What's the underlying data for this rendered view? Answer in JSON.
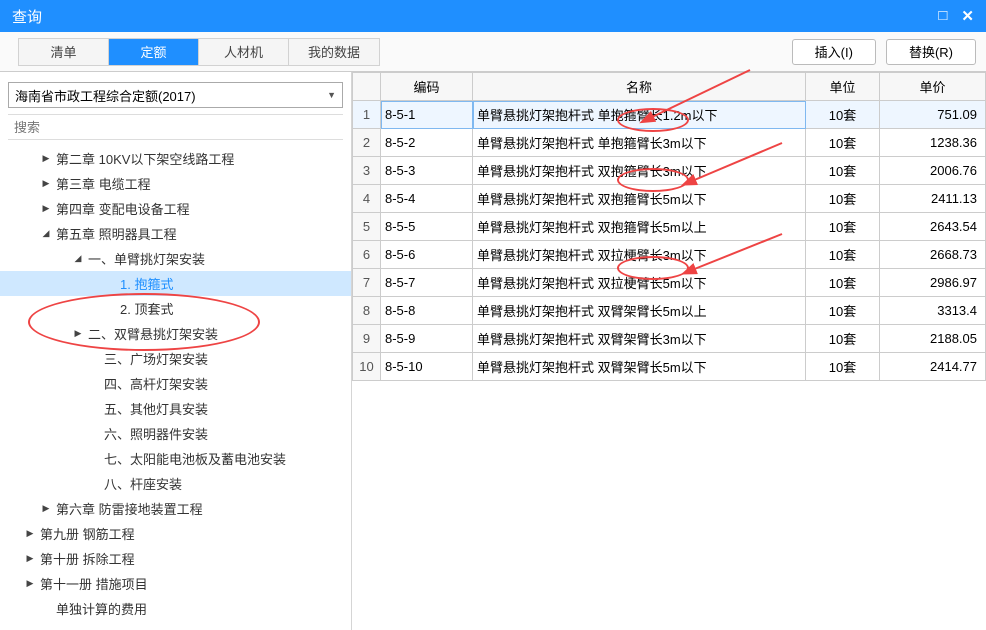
{
  "window": {
    "title": "查询"
  },
  "tabs": [
    {
      "label": "清单",
      "active": false
    },
    {
      "label": "定额",
      "active": true
    },
    {
      "label": "人材机",
      "active": false
    },
    {
      "label": "我的数据",
      "active": false
    }
  ],
  "buttons": {
    "insert": "插入(I)",
    "replace": "替换(R)"
  },
  "dropdown": {
    "value": "海南省市政工程综合定额(2017)"
  },
  "search": {
    "placeholder": "搜索"
  },
  "tree": [
    {
      "indent": 40,
      "toggle": "▶",
      "label": "第二章 10KV以下架空线路工程",
      "selected": false
    },
    {
      "indent": 40,
      "toggle": "▶",
      "label": "第三章 电缆工程",
      "selected": false
    },
    {
      "indent": 40,
      "toggle": "▶",
      "label": "第四章 变配电设备工程",
      "selected": false
    },
    {
      "indent": 40,
      "toggle": "◢",
      "label": "第五章 照明器具工程",
      "selected": false
    },
    {
      "indent": 72,
      "toggle": "◢",
      "label": "一、单臂挑灯架安装",
      "selected": false
    },
    {
      "indent": 104,
      "toggle": "",
      "label": "1. 抱箍式",
      "selected": true
    },
    {
      "indent": 104,
      "toggle": "",
      "label": "2. 顶套式",
      "selected": false
    },
    {
      "indent": 72,
      "toggle": "▶",
      "label": "二、双臂悬挑灯架安装",
      "selected": false
    },
    {
      "indent": 88,
      "toggle": "",
      "label": "三、广场灯架安装",
      "selected": false
    },
    {
      "indent": 88,
      "toggle": "",
      "label": "四、高杆灯架安装",
      "selected": false
    },
    {
      "indent": 88,
      "toggle": "",
      "label": "五、其他灯具安装",
      "selected": false
    },
    {
      "indent": 88,
      "toggle": "",
      "label": "六、照明器件安装",
      "selected": false
    },
    {
      "indent": 88,
      "toggle": "",
      "label": "七、太阳能电池板及蓄电池安装",
      "selected": false
    },
    {
      "indent": 88,
      "toggle": "",
      "label": "八、杆座安装",
      "selected": false
    },
    {
      "indent": 40,
      "toggle": "▶",
      "label": "第六章 防雷接地装置工程",
      "selected": false
    },
    {
      "indent": 24,
      "toggle": "▶",
      "label": "第九册 钢筋工程",
      "selected": false
    },
    {
      "indent": 24,
      "toggle": "▶",
      "label": "第十册 拆除工程",
      "selected": false
    },
    {
      "indent": 24,
      "toggle": "▶",
      "label": "第十一册 措施项目",
      "selected": false
    },
    {
      "indent": 40,
      "toggle": "",
      "label": "单独计算的费用",
      "selected": false
    }
  ],
  "table": {
    "headers": {
      "code": "编码",
      "name": "名称",
      "unit": "单位",
      "price": "单价"
    },
    "rows": [
      {
        "n": "1",
        "code": "8-5-1",
        "name": "单臂悬挑灯架抱杆式 单抱箍臂长1.2m以下",
        "unit": "10套",
        "price": "751.09",
        "sel": true
      },
      {
        "n": "2",
        "code": "8-5-2",
        "name": "单臂悬挑灯架抱杆式 单抱箍臂长3m以下",
        "unit": "10套",
        "price": "1238.36"
      },
      {
        "n": "3",
        "code": "8-5-3",
        "name": "单臂悬挑灯架抱杆式 双抱箍臂长3m以下",
        "unit": "10套",
        "price": "2006.76"
      },
      {
        "n": "4",
        "code": "8-5-4",
        "name": "单臂悬挑灯架抱杆式 双抱箍臂长5m以下",
        "unit": "10套",
        "price": "2411.13"
      },
      {
        "n": "5",
        "code": "8-5-5",
        "name": "单臂悬挑灯架抱杆式 双抱箍臂长5m以上",
        "unit": "10套",
        "price": "2643.54"
      },
      {
        "n": "6",
        "code": "8-5-6",
        "name": "单臂悬挑灯架抱杆式 双拉梗臂长3m以下",
        "unit": "10套",
        "price": "2668.73"
      },
      {
        "n": "7",
        "code": "8-5-7",
        "name": "单臂悬挑灯架抱杆式 双拉梗臂长5m以下",
        "unit": "10套",
        "price": "2986.97"
      },
      {
        "n": "8",
        "code": "8-5-8",
        "name": "单臂悬挑灯架抱杆式 双臂架臂长5m以上",
        "unit": "10套",
        "price": "3313.4"
      },
      {
        "n": "9",
        "code": "8-5-9",
        "name": "单臂悬挑灯架抱杆式 双臂架臂长3m以下",
        "unit": "10套",
        "price": "2188.05"
      },
      {
        "n": "10",
        "code": "8-5-10",
        "name": "单臂悬挑灯架抱杆式 双臂架臂长5m以下",
        "unit": "10套",
        "price": "2414.77"
      }
    ]
  }
}
